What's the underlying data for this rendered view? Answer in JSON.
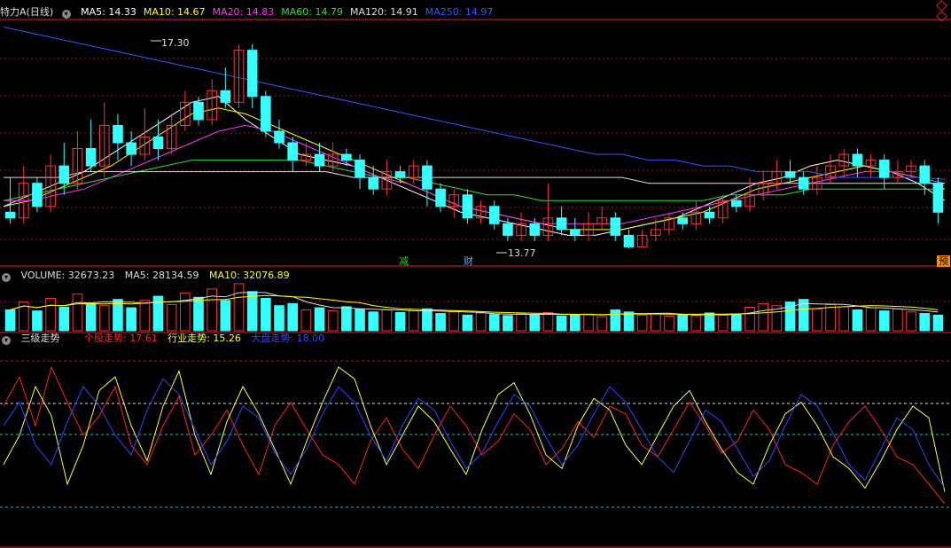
{
  "price_panel": {
    "title": "特力A(日线)",
    "ma_legend": [
      {
        "label": "MA5: 14.33",
        "color": "#ffffff"
      },
      {
        "label": "MA10: 14.67",
        "color": "#ffff00"
      },
      {
        "label": "MA20: 14.83",
        "color": "#ff33ff"
      },
      {
        "label": "MA60: 14.79",
        "color": "#33dd33"
      },
      {
        "label": "MA120: 14.91",
        "color": "#dddddd"
      },
      {
        "label": "MA250: 14.97",
        "color": "#3355ff"
      }
    ],
    "high_label": "17.30",
    "low_label": "13.77",
    "badges": [
      {
        "text": "减",
        "color": "#33cc33"
      },
      {
        "text": "财",
        "color": "#66aaff"
      },
      {
        "text": "预",
        "color": "#ff8800"
      }
    ]
  },
  "volume_panel": {
    "legend": [
      {
        "label": "VOLUME: 32673.23",
        "color": "#dddddd"
      },
      {
        "label": "MA5: 28134.59",
        "color": "#dddddd"
      },
      {
        "label": "MA10: 32076.89",
        "color": "#ffff00"
      }
    ]
  },
  "trend_panel": {
    "title": "三级走势",
    "legend": [
      {
        "label": "个股走势: 17.61",
        "color": "#ff2222"
      },
      {
        "label": "行业走势: 15.26",
        "color": "#ffff33"
      },
      {
        "label": "大盘走势: 18.00",
        "color": "#3344ff"
      }
    ]
  },
  "chart_data": {
    "type": "candlestick",
    "title": "特力A(日线)",
    "price_range": [
      13.5,
      17.7
    ],
    "candles": [
      [
        14.4,
        14.3,
        15.0,
        14.2
      ],
      [
        14.3,
        14.9,
        15.2,
        14.2
      ],
      [
        14.9,
        14.5,
        15.0,
        14.4
      ],
      [
        14.5,
        15.2,
        15.4,
        14.4
      ],
      [
        15.2,
        14.9,
        15.6,
        14.7
      ],
      [
        14.9,
        15.5,
        15.8,
        14.8
      ],
      [
        15.5,
        15.2,
        16.0,
        15.1
      ],
      [
        15.2,
        15.9,
        16.3,
        15.0
      ],
      [
        15.9,
        15.6,
        16.1,
        15.3
      ],
      [
        15.6,
        15.4,
        15.8,
        15.2
      ],
      [
        15.4,
        15.7,
        16.2,
        15.3
      ],
      [
        15.7,
        15.5,
        16.0,
        15.3
      ],
      [
        15.5,
        15.9,
        16.1,
        15.4
      ],
      [
        15.9,
        16.3,
        16.5,
        15.8
      ],
      [
        16.3,
        16.0,
        16.4,
        15.9
      ],
      [
        16.0,
        16.5,
        16.7,
        15.9
      ],
      [
        16.5,
        16.3,
        16.9,
        16.2
      ],
      [
        16.3,
        17.2,
        17.3,
        16.2
      ],
      [
        17.2,
        16.4,
        17.3,
        16.2
      ],
      [
        16.4,
        15.8,
        16.5,
        15.7
      ],
      [
        15.8,
        15.6,
        16.0,
        15.5
      ],
      [
        15.6,
        15.3,
        15.7,
        15.1
      ],
      [
        15.3,
        15.4,
        15.6,
        15.2
      ],
      [
        15.4,
        15.2,
        15.6,
        15.1
      ],
      [
        15.2,
        15.4,
        15.6,
        15.1
      ],
      [
        15.4,
        15.3,
        15.5,
        15.2
      ],
      [
        15.3,
        15.0,
        15.4,
        14.8
      ],
      [
        15.0,
        14.8,
        15.2,
        14.7
      ],
      [
        14.8,
        15.1,
        15.3,
        14.7
      ],
      [
        15.1,
        15.0,
        15.2,
        14.9
      ],
      [
        15.0,
        15.2,
        15.3,
        14.9
      ],
      [
        15.2,
        14.8,
        15.3,
        14.5
      ],
      [
        14.8,
        14.5,
        14.9,
        14.4
      ],
      [
        14.5,
        14.7,
        14.8,
        14.3
      ],
      [
        14.7,
        14.3,
        14.8,
        14.2
      ],
      [
        14.3,
        14.5,
        14.6,
        14.2
      ],
      [
        14.5,
        14.2,
        14.6,
        14.1
      ],
      [
        14.2,
        14.0,
        14.3,
        13.9
      ],
      [
        14.0,
        14.2,
        14.4,
        13.9
      ],
      [
        14.2,
        14.0,
        14.3,
        13.9
      ],
      [
        14.0,
        14.3,
        14.9,
        13.9
      ],
      [
        14.3,
        14.1,
        14.5,
        14.0
      ],
      [
        14.1,
        14.0,
        14.3,
        13.9
      ],
      [
        14.0,
        14.2,
        14.4,
        13.9
      ],
      [
        14.2,
        14.3,
        14.5,
        14.1
      ],
      [
        14.3,
        14.0,
        14.4,
        13.9
      ],
      [
        14.0,
        13.8,
        14.1,
        13.77
      ],
      [
        13.8,
        14.0,
        14.1,
        13.8
      ],
      [
        14.0,
        14.1,
        14.3,
        13.9
      ],
      [
        14.1,
        14.3,
        14.4,
        14.0
      ],
      [
        14.3,
        14.2,
        14.4,
        14.1
      ],
      [
        14.2,
        14.4,
        14.6,
        14.1
      ],
      [
        14.4,
        14.3,
        14.5,
        14.2
      ],
      [
        14.3,
        14.6,
        14.7,
        14.2
      ],
      [
        14.6,
        14.5,
        14.7,
        14.4
      ],
      [
        14.5,
        14.7,
        15.0,
        14.4
      ],
      [
        14.7,
        14.9,
        15.1,
        14.6
      ],
      [
        14.9,
        15.1,
        15.3,
        14.8
      ],
      [
        15.1,
        15.0,
        15.3,
        14.9
      ],
      [
        15.0,
        14.8,
        15.1,
        14.7
      ],
      [
        14.8,
        15.0,
        15.2,
        14.7
      ],
      [
        15.0,
        15.2,
        15.4,
        14.9
      ],
      [
        15.2,
        15.4,
        15.5,
        15.0
      ],
      [
        15.4,
        15.2,
        15.5,
        15.0
      ],
      [
        15.2,
        15.3,
        15.4,
        15.0
      ],
      [
        15.3,
        15.0,
        15.4,
        14.8
      ],
      [
        15.0,
        15.1,
        15.3,
        14.9
      ],
      [
        15.1,
        15.2,
        15.3,
        15.0
      ],
      [
        15.2,
        14.9,
        15.3,
        14.7
      ],
      [
        14.9,
        14.4,
        15.0,
        14.2
      ]
    ],
    "ma_series": [
      {
        "name": "MA5",
        "values": [
          14.5,
          14.7,
          14.9,
          15.1,
          15.4,
          15.7,
          16.0,
          16.3,
          16.4,
          16.0,
          15.7,
          15.4,
          15.3,
          15.2,
          15.0,
          14.8,
          14.6,
          14.4,
          14.3,
          14.2,
          14.1,
          14.0,
          14.0,
          14.1,
          14.2,
          14.3,
          14.5,
          14.7,
          14.9,
          15.0,
          15.2,
          15.3,
          15.2,
          15.1,
          14.9,
          14.6
        ]
      },
      {
        "name": "MA10",
        "values": [
          14.5,
          14.6,
          14.8,
          15.0,
          15.2,
          15.5,
          15.8,
          16.1,
          16.2,
          16.1,
          15.9,
          15.7,
          15.5,
          15.3,
          15.1,
          14.9,
          14.7,
          14.5,
          14.4,
          14.3,
          14.2,
          14.1,
          14.1,
          14.1,
          14.2,
          14.3,
          14.4,
          14.6,
          14.8,
          14.9,
          15.0,
          15.1,
          15.2,
          15.1,
          15.0,
          14.8
        ]
      },
      {
        "name": "MA20",
        "values": [
          14.6,
          14.6,
          14.7,
          14.8,
          15.0,
          15.2,
          15.4,
          15.6,
          15.8,
          15.9,
          15.8,
          15.6,
          15.4,
          15.2,
          15.0,
          14.9,
          14.7,
          14.5,
          14.4,
          14.3,
          14.2,
          14.2,
          14.2,
          14.2,
          14.3,
          14.4,
          14.5,
          14.6,
          14.7,
          14.8,
          14.9,
          15.0,
          15.1,
          15.1,
          15.0,
          14.9
        ]
      },
      {
        "name": "MA60",
        "values": [
          14.6,
          14.7,
          14.8,
          14.9,
          15.0,
          15.1,
          15.2,
          15.3,
          15.3,
          15.3,
          15.3,
          15.3,
          15.2,
          15.1,
          15.0,
          15.0,
          14.9,
          14.8,
          14.7,
          14.7,
          14.6,
          14.6,
          14.6,
          14.6,
          14.6,
          14.6,
          14.6,
          14.7,
          14.7,
          14.7,
          14.8,
          14.8,
          14.8,
          14.8,
          14.8,
          14.8
        ]
      },
      {
        "name": "MA120",
        "values": [
          15.0,
          15.0,
          15.0,
          15.1,
          15.1,
          15.1,
          15.1,
          15.1,
          15.1,
          15.1,
          15.1,
          15.1,
          15.1,
          15.0,
          15.0,
          15.0,
          15.0,
          15.0,
          15.0,
          15.0,
          15.0,
          15.0,
          15.0,
          15.0,
          14.9,
          14.9,
          14.9,
          14.9,
          14.9,
          14.9,
          14.9,
          14.9,
          14.9,
          14.9,
          14.9,
          14.9
        ]
      },
      {
        "name": "MA250",
        "values": [
          17.6,
          17.5,
          17.4,
          17.3,
          17.2,
          17.1,
          17.0,
          16.9,
          16.8,
          16.7,
          16.6,
          16.5,
          16.4,
          16.3,
          16.2,
          16.1,
          16.0,
          15.9,
          15.8,
          15.7,
          15.6,
          15.5,
          15.4,
          15.4,
          15.3,
          15.3,
          15.2,
          15.2,
          15.1,
          15.1,
          15.1,
          15.0,
          15.0,
          15.0,
          15.0,
          14.97
        ]
      }
    ],
    "volume": [
      40,
      55,
      38,
      62,
      45,
      70,
      52,
      48,
      60,
      44,
      58,
      66,
      50,
      72,
      64,
      80,
      58,
      90,
      75,
      62,
      48,
      52,
      40,
      44,
      38,
      46,
      42,
      36,
      40,
      35,
      38,
      42,
      33,
      36,
      30,
      34,
      31,
      29,
      33,
      30,
      35,
      28,
      30,
      32,
      27,
      40,
      36,
      30,
      33,
      28,
      31,
      29,
      34,
      30,
      32,
      45,
      52,
      48,
      55,
      60,
      42,
      50,
      46,
      40,
      44,
      38,
      42,
      36,
      33,
      30
    ],
    "trend_series": [
      {
        "name": "个股走势",
        "values": [
          70,
          85,
          60,
          90,
          72,
          55,
          65,
          80,
          50,
          40,
          60,
          75,
          45,
          55,
          68,
          50,
          35,
          60,
          72,
          58,
          45,
          40,
          30,
          52,
          64,
          48,
          38,
          55,
          70,
          60,
          45,
          52,
          66,
          58,
          40,
          48,
          62,
          54,
          70,
          66,
          50,
          44,
          58,
          72,
          60,
          46,
          52,
          68,
          58,
          40,
          36,
          30,
          50,
          62,
          70,
          58,
          44,
          40,
          30,
          20
        ]
      },
      {
        "name": "行业走势",
        "values": [
          40,
          55,
          80,
          65,
          30,
          50,
          78,
          85,
          60,
          42,
          70,
          88,
          55,
          35,
          62,
          80,
          66,
          48,
          30,
          52,
          72,
          90,
          84,
          60,
          40,
          55,
          70,
          62,
          48,
          35,
          58,
          76,
          82,
          66,
          45,
          38,
          60,
          74,
          68,
          50,
          40,
          55,
          70,
          78,
          62,
          48,
          36,
          30,
          50,
          66,
          72,
          60,
          44,
          38,
          28,
          42,
          58,
          70,
          64,
          26
        ]
      },
      {
        "name": "大盘走势",
        "values": [
          60,
          72,
          50,
          40,
          62,
          80,
          70,
          55,
          45,
          68,
          84,
          76,
          58,
          40,
          52,
          70,
          64,
          46,
          35,
          48,
          66,
          80,
          72,
          55,
          42,
          60,
          74,
          68,
          52,
          38,
          46,
          62,
          76,
          70,
          54,
          40,
          50,
          66,
          80,
          72,
          58,
          44,
          36,
          52,
          68,
          62,
          48,
          34,
          42,
          60,
          76,
          70,
          56,
          40,
          32,
          48,
          64,
          58,
          40,
          28
        ]
      }
    ]
  }
}
